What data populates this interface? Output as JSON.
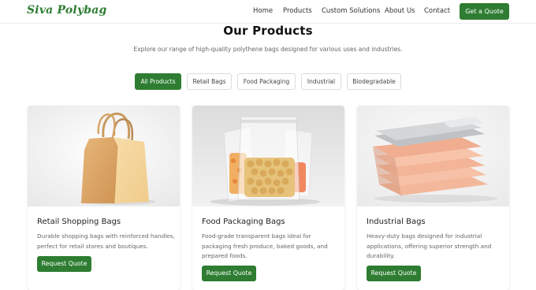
{
  "brand": {
    "name": "Siva Polybag",
    "color": "#2e7d32"
  },
  "nav": {
    "links": [
      "Home",
      "Products",
      "Custom Solutions",
      "About Us",
      "Contact"
    ],
    "cta_label": "Get a Quote"
  },
  "page": {
    "title": "Our Products",
    "subtitle": "Explore our range of high-quality polythene bags designed for various uses and industries."
  },
  "filters": {
    "active": "All Products",
    "items": [
      "All Products",
      "Retail Bags",
      "Food Packaging",
      "Industrial",
      "Biodegradable"
    ]
  },
  "products": [
    {
      "title": "Retail Shopping Bags",
      "description": "Durable shopping bags with reinforced handles, perfect for retail stores and boutiques.",
      "button_label": "Request Quote",
      "image_icon": "paper-shopping-bag"
    },
    {
      "title": "Food Packaging Bags",
      "description": "Food-grade transparent bags ideal for packaging fresh produce, baked goods, and prepared foods.",
      "button_label": "Request Quote",
      "image_icon": "transparent-food-bags"
    },
    {
      "title": "Industrial Bags",
      "description": "Heavy-duty bags designed for industrial applications, offering superior strength and durability.",
      "button_label": "Request Quote",
      "image_icon": "stacked-industrial-bags"
    }
  ],
  "colors": {
    "accent": "#2e7d32",
    "text": "#222222",
    "muted": "#666666",
    "border": "#d9dcdf"
  }
}
